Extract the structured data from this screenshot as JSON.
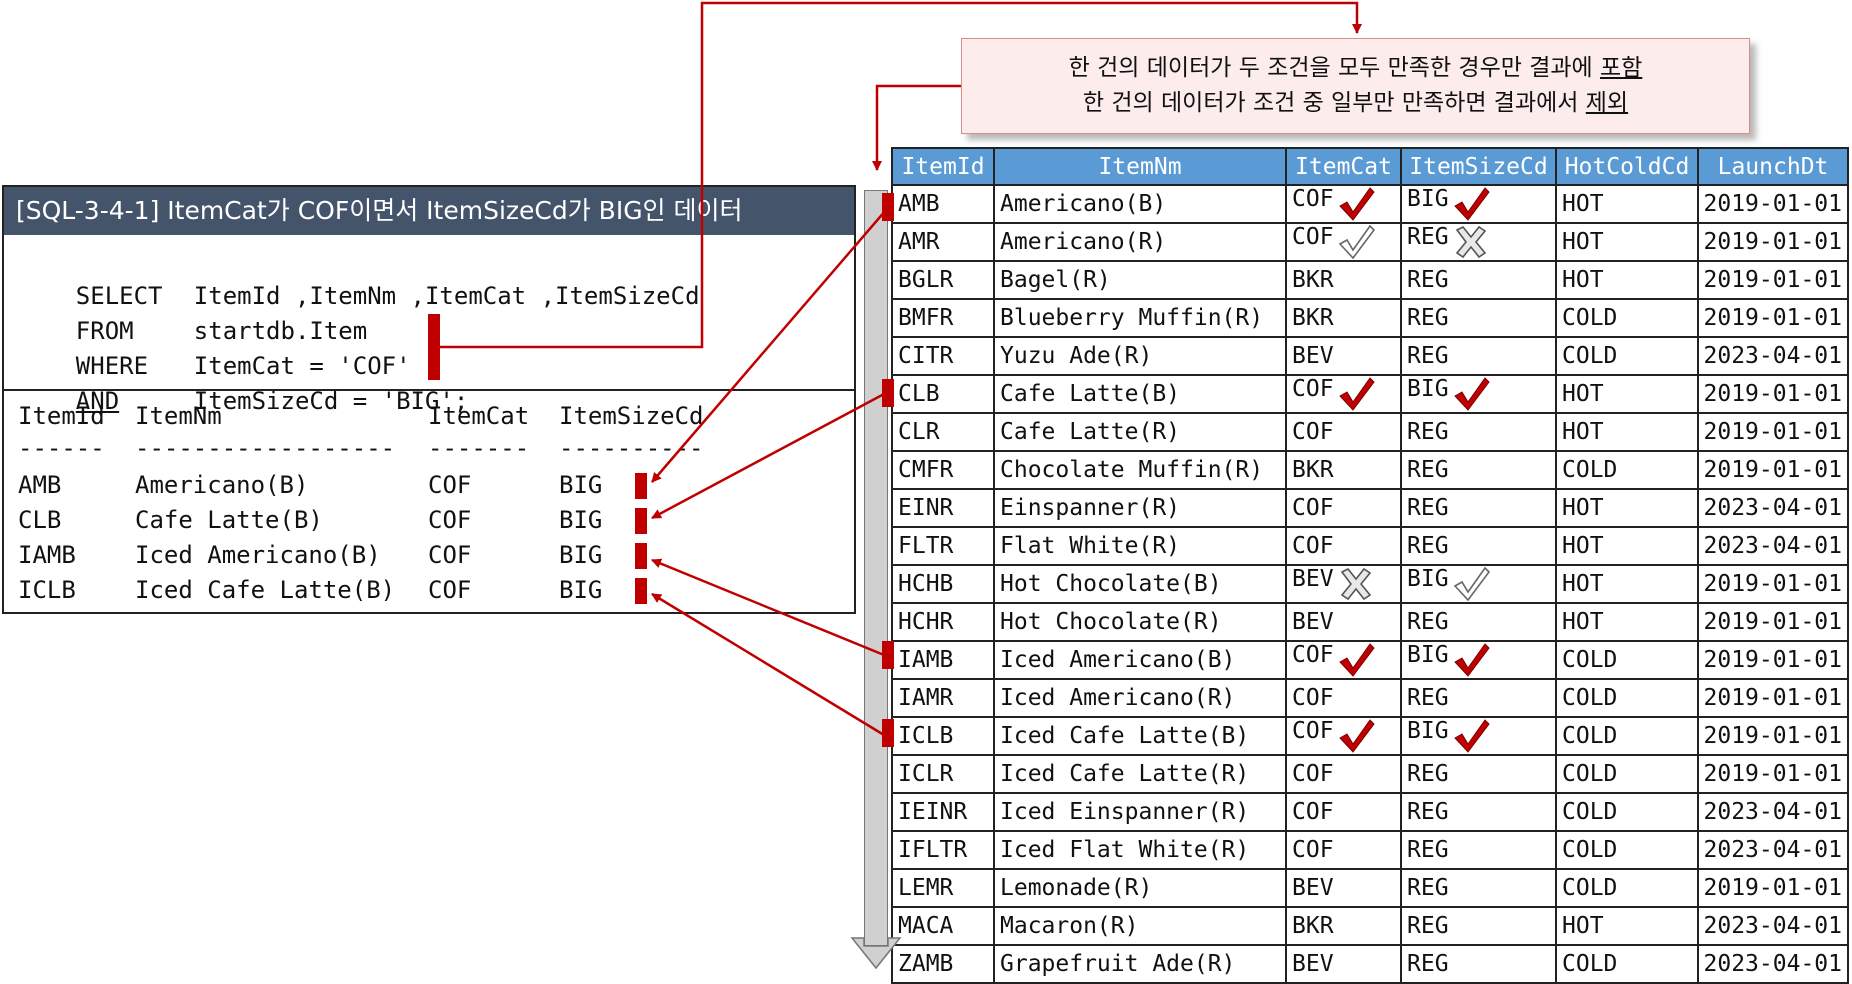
{
  "sql_panel": {
    "title": "[SQL-3-4-1] ItemCat가 COF이면서 ItemSizeCd가 BIG인 데이터",
    "query_lines": [
      {
        "keyword": "SELECT",
        "text": "ItemId ,ItemNm ,ItemCat ,ItemSizeCd",
        "underline": false
      },
      {
        "keyword": "FROM",
        "text": "startdb.Item",
        "underline": false
      },
      {
        "keyword": "WHERE",
        "text": "ItemCat = 'COF'",
        "underline": false
      },
      {
        "keyword": "AND",
        "text": "ItemSizeCd = 'BIG';",
        "underline": true
      }
    ],
    "result": {
      "headers": [
        "ItemId",
        "ItemNm",
        "ItemCat",
        "ItemSizeCd"
      ],
      "separators": [
        "------",
        "------------------",
        "-------",
        "----------"
      ],
      "rows": [
        [
          "AMB",
          "Americano(B)",
          "COF",
          "BIG"
        ],
        [
          "CLB",
          "Cafe Latte(B)",
          "COF",
          "BIG"
        ],
        [
          "IAMB",
          "Iced Americano(B)",
          "COF",
          "BIG"
        ],
        [
          "ICLB",
          "Iced Cafe Latte(B)",
          "COF",
          "BIG"
        ]
      ]
    }
  },
  "callout": {
    "line1_main": "한 건의 데이터가 두 조건을 모두 만족한 경우만 결과에 ",
    "line1_emph": "포함",
    "line2_main": "한 건의 데이터가 조건 중 일부만 만족하면 결과에서 ",
    "line2_emph": "제외"
  },
  "table": {
    "headers": [
      "ItemId",
      "ItemNm",
      "ItemCat",
      "ItemSizeCd",
      "HotColdCd",
      "LaunchDt"
    ],
    "rows": [
      {
        "cells": [
          "AMB",
          "Americano(B)",
          "COF",
          "BIG",
          "HOT",
          "2019-01-01"
        ],
        "cat_mark": "check-red",
        "size_mark": "check-red"
      },
      {
        "cells": [
          "AMR",
          "Americano(R)",
          "COF",
          "REG",
          "HOT",
          "2019-01-01"
        ],
        "cat_mark": "check-gray",
        "size_mark": "x-gray"
      },
      {
        "cells": [
          "BGLR",
          "Bagel(R)",
          "BKR",
          "REG",
          "HOT",
          "2019-01-01"
        ],
        "cat_mark": "",
        "size_mark": ""
      },
      {
        "cells": [
          "BMFR",
          "Blueberry Muffin(R)",
          "BKR",
          "REG",
          "COLD",
          "2019-01-01"
        ],
        "cat_mark": "",
        "size_mark": ""
      },
      {
        "cells": [
          "CITR",
          "Yuzu Ade(R)",
          "BEV",
          "REG",
          "COLD",
          "2023-04-01"
        ],
        "cat_mark": "",
        "size_mark": ""
      },
      {
        "cells": [
          "CLB",
          "Cafe Latte(B)",
          "COF",
          "BIG",
          "HOT",
          "2019-01-01"
        ],
        "cat_mark": "check-red",
        "size_mark": "check-red"
      },
      {
        "cells": [
          "CLR",
          "Cafe Latte(R)",
          "COF",
          "REG",
          "HOT",
          "2019-01-01"
        ],
        "cat_mark": "",
        "size_mark": ""
      },
      {
        "cells": [
          "CMFR",
          "Chocolate Muffin(R)",
          "BKR",
          "REG",
          "COLD",
          "2019-01-01"
        ],
        "cat_mark": "",
        "size_mark": ""
      },
      {
        "cells": [
          "EINR",
          "Einspanner(R)",
          "COF",
          "REG",
          "HOT",
          "2023-04-01"
        ],
        "cat_mark": "",
        "size_mark": ""
      },
      {
        "cells": [
          "FLTR",
          "Flat White(R)",
          "COF",
          "REG",
          "HOT",
          "2023-04-01"
        ],
        "cat_mark": "",
        "size_mark": ""
      },
      {
        "cells": [
          "HCHB",
          "Hot Chocolate(B)",
          "BEV",
          "BIG",
          "HOT",
          "2019-01-01"
        ],
        "cat_mark": "x-gray",
        "size_mark": "check-gray"
      },
      {
        "cells": [
          "HCHR",
          "Hot Chocolate(R)",
          "BEV",
          "REG",
          "HOT",
          "2019-01-01"
        ],
        "cat_mark": "",
        "size_mark": ""
      },
      {
        "cells": [
          "IAMB",
          "Iced Americano(B)",
          "COF",
          "BIG",
          "COLD",
          "2019-01-01"
        ],
        "cat_mark": "check-red",
        "size_mark": "check-red"
      },
      {
        "cells": [
          "IAMR",
          "Iced Americano(R)",
          "COF",
          "REG",
          "COLD",
          "2019-01-01"
        ],
        "cat_mark": "",
        "size_mark": ""
      },
      {
        "cells": [
          "ICLB",
          "Iced Cafe Latte(B)",
          "COF",
          "BIG",
          "COLD",
          "2019-01-01"
        ],
        "cat_mark": "check-red",
        "size_mark": "check-red"
      },
      {
        "cells": [
          "ICLR",
          "Iced Cafe Latte(R)",
          "COF",
          "REG",
          "COLD",
          "2019-01-01"
        ],
        "cat_mark": "",
        "size_mark": ""
      },
      {
        "cells": [
          "IEINR",
          "Iced Einspanner(R)",
          "COF",
          "REG",
          "COLD",
          "2023-04-01"
        ],
        "cat_mark": "",
        "size_mark": ""
      },
      {
        "cells": [
          "IFLTR",
          "Iced Flat White(R)",
          "COF",
          "REG",
          "COLD",
          "2023-04-01"
        ],
        "cat_mark": "",
        "size_mark": ""
      },
      {
        "cells": [
          "LEMR",
          "Lemonade(R)",
          "BEV",
          "REG",
          "COLD",
          "2019-01-01"
        ],
        "cat_mark": "",
        "size_mark": ""
      },
      {
        "cells": [
          "MACA",
          "Macaron(R)",
          "BKR",
          "REG",
          "HOT",
          "2023-04-01"
        ],
        "cat_mark": "",
        "size_mark": ""
      },
      {
        "cells": [
          "ZAMB",
          "Grapefruit Ade(R)",
          "BEV",
          "REG",
          "COLD",
          "2023-04-01"
        ],
        "cat_mark": "",
        "size_mark": ""
      }
    ]
  },
  "colors": {
    "title_bar": "#44546a",
    "header_fill": "#5b9bd5",
    "accent_red": "#c00000",
    "callout_fill": "#fdecec",
    "scroll_gray": "#d0d0d0"
  },
  "icons": {
    "check-red": "red check mark",
    "check-gray": "gray outlined check mark",
    "x-gray": "gray outlined x mark"
  }
}
